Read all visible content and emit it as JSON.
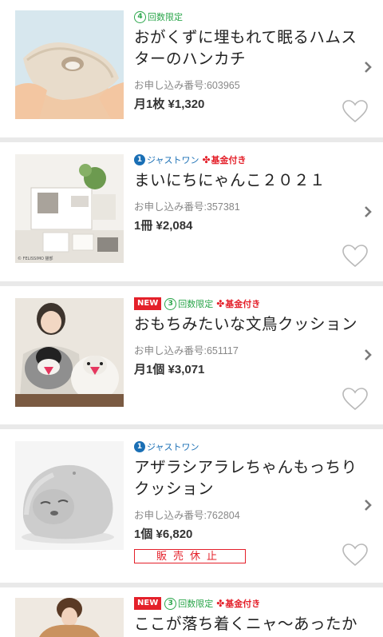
{
  "items": [
    {
      "badges": {
        "limit": "回数限定",
        "limit_num": "4"
      },
      "title_lines": [
        "おがくずに埋もれて眠るハムス",
        "ターのハンカチ"
      ],
      "order_no": "お申し込み番号:603965",
      "price": "月1枚 ¥1,320"
    },
    {
      "badges": {
        "just": "ジャストワン",
        "fund": "基金付き"
      },
      "title_lines": [
        "まいにちにゃんこ２０２１"
      ],
      "order_no": "お申し込み番号:357381",
      "price": "1冊 ¥2,084",
      "photo_credit": "© FELISSIMO 猫部"
    },
    {
      "badges": {
        "new": "NEW",
        "limit": "回数限定",
        "limit_num": "3",
        "fund": "基金付き"
      },
      "title_lines": [
        "おもちみたいな文鳥クッション"
      ],
      "order_no": "お申し込み番号:651117",
      "price": "月1個 ¥3,071"
    },
    {
      "badges": {
        "just": "ジャストワン"
      },
      "title_lines": [
        "アザラシアラレちゃんもっちり",
        "クッション"
      ],
      "order_no": "お申し込み番号:762804",
      "price": "1個 ¥6,820",
      "status": "販売休止"
    },
    {
      "badges": {
        "new": "NEW",
        "limit": "回数限定",
        "limit_num": "3",
        "fund": "基金付き"
      },
      "title_lines": [
        "ここが落ち着くニャ〜あったか"
      ]
    }
  ]
}
